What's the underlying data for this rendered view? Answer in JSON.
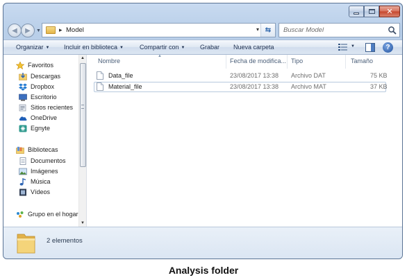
{
  "window": {
    "controls": {
      "minimize": "minimize-icon",
      "maximize": "maximize-icon",
      "close": "close-icon"
    }
  },
  "navigation": {
    "path_separator": "▸",
    "path": "Model",
    "search_placeholder": "Buscar Model"
  },
  "toolbar": {
    "organize": "Organizar",
    "include_library": "Incluir en biblioteca",
    "share_with": "Compartir con",
    "burn": "Grabar",
    "new_folder": "Nueva carpeta"
  },
  "sidebar": {
    "favorites": {
      "label": "Favoritos",
      "items": [
        {
          "label": "Descargas",
          "icon": "downloads-icon"
        },
        {
          "label": "Dropbox",
          "icon": "dropbox-icon"
        },
        {
          "label": "Escritorio",
          "icon": "desktop-icon"
        },
        {
          "label": "Sitios recientes",
          "icon": "recent-places-icon"
        },
        {
          "label": "OneDrive",
          "icon": "onedrive-icon"
        },
        {
          "label": "Egnyte",
          "icon": "egnyte-icon"
        }
      ]
    },
    "libraries": {
      "label": "Bibliotecas",
      "items": [
        {
          "label": "Documentos",
          "icon": "documents-icon"
        },
        {
          "label": "Imágenes",
          "icon": "pictures-icon"
        },
        {
          "label": "Música",
          "icon": "music-icon"
        },
        {
          "label": "Vídeos",
          "icon": "videos-icon"
        }
      ]
    },
    "homegroup": {
      "label": "Grupo en el hogar",
      "icon": "homegroup-icon"
    }
  },
  "file_list": {
    "columns": [
      "Nombre",
      "Fecha de modifica...",
      "Tipo",
      "Tamaño"
    ],
    "rows": [
      {
        "name": "Data_file",
        "date": "23/08/2017 13:38",
        "type": "Archivo DAT",
        "size": "75 KB",
        "selected": false
      },
      {
        "name": "Material_file",
        "date": "23/08/2017 13:38",
        "type": "Archivo MAT",
        "size": "37 KB",
        "selected": true
      }
    ]
  },
  "status": {
    "item_count": "2 elementos"
  },
  "caption": "Analysis folder",
  "colors": {
    "chrome": "#c3d6ed",
    "toolbar_text": "#1e3050",
    "header_text": "#4c607a",
    "close_button": "#c6452b",
    "selection_border": "#b7c9de"
  }
}
